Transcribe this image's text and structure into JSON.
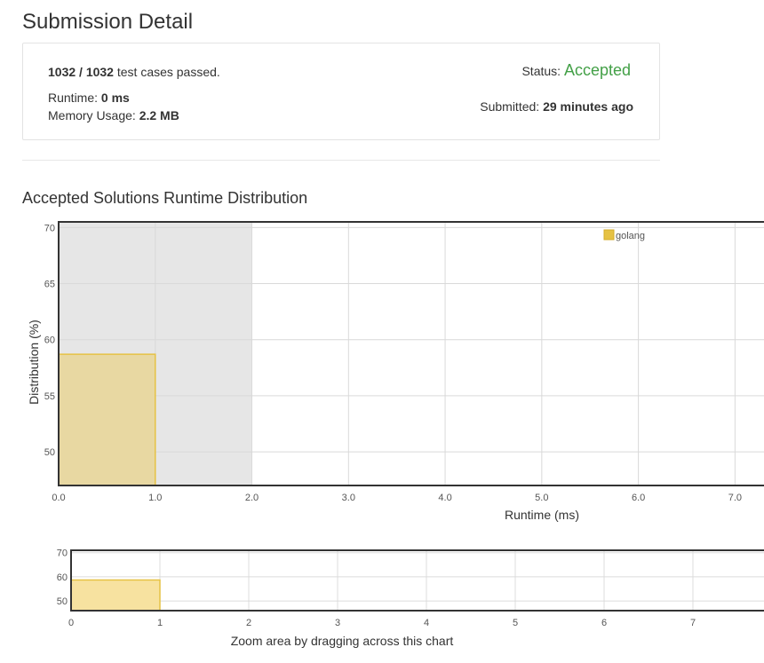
{
  "page": {
    "title": "Submission Detail",
    "section_title": "Accepted Solutions Runtime Distribution",
    "zoom_hint": "Zoom area by dragging across this chart"
  },
  "summary": {
    "passed_count": "1032 / 1032",
    "passed_suffix": " test cases passed.",
    "status_label": "Status: ",
    "status_value": "Accepted",
    "runtime_label": "Runtime: ",
    "runtime_value": "0 ms",
    "memory_label": "Memory Usage: ",
    "memory_value": "2.2 MB",
    "submitted_label": "Submitted: ",
    "submitted_value": "29 minutes ago"
  },
  "colors": {
    "accepted": "#43a047",
    "bar_fill": "#e8d8a2",
    "bar_stroke": "#e6c244",
    "nav_bar_fill": "#f7e2a0",
    "highlight": "#e6e6e6"
  },
  "chart_data": [
    {
      "type": "bar",
      "title": "Accepted Solutions Runtime Distribution",
      "xlabel": "Runtime (ms)",
      "ylabel": "Distribution (%)",
      "xlim": [
        0,
        7.3
      ],
      "ylim": [
        47,
        70.5
      ],
      "x_ticks": [
        "0.0",
        "1.0",
        "2.0",
        "3.0",
        "4.0",
        "5.0",
        "6.0",
        "7.0"
      ],
      "y_ticks": [
        "50",
        "55",
        "60",
        "65",
        "70"
      ],
      "highlight_range": [
        0,
        2
      ],
      "grid": true,
      "legend": "top-right",
      "series": [
        {
          "name": "golang",
          "bars": [
            {
              "x0": 0,
              "x1": 1,
              "value": 58.7
            }
          ]
        }
      ]
    },
    {
      "type": "bar",
      "xlim": [
        0,
        7.8
      ],
      "ylim": [
        46,
        71
      ],
      "x_ticks": [
        "0",
        "1",
        "2",
        "3",
        "4",
        "5",
        "6",
        "7"
      ],
      "y_ticks": [
        "50",
        "60",
        "70"
      ],
      "grid": true,
      "series": [
        {
          "bars": [
            {
              "x0": 0,
              "x1": 1,
              "value": 58.7
            }
          ]
        }
      ]
    }
  ]
}
